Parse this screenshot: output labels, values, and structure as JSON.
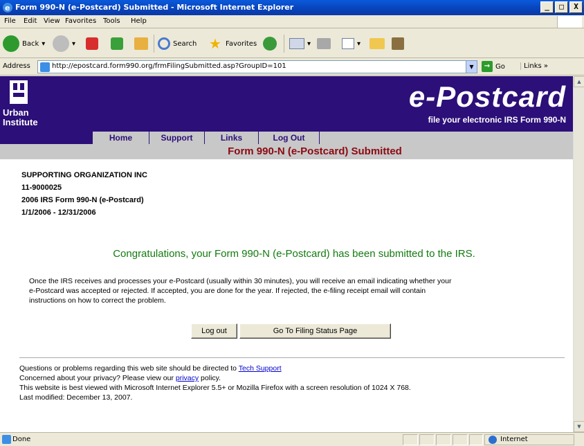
{
  "window": {
    "title": "Form 990-N (e-Postcard) Submitted - Microsoft Internet Explorer",
    "minimize": "_",
    "maximize": "□",
    "close": "X"
  },
  "menu": [
    "File",
    "Edit",
    "View",
    "Favorites",
    "Tools",
    "Help"
  ],
  "toolbar": {
    "back": "Back",
    "search": "Search",
    "favorites": "Favorites"
  },
  "address": {
    "label": "Address",
    "url": "http://epostcard.form990.org/frmFilingSubmitted.asp?GroupID=101",
    "go": "Go",
    "links": "Links"
  },
  "banner": {
    "org": "Urban Institute",
    "brand": "e-Postcard",
    "tagline": "file your electronic IRS Form 990-N"
  },
  "nav": [
    "Home",
    "Support",
    "Links",
    "Log Out"
  ],
  "page": {
    "subtitle": "Form 990-N (e-Postcard) Submitted",
    "org_name": "SUPPORTING ORGANIZATION INC",
    "ein": "11-9000025",
    "form": "2006 IRS Form 990-N (e-Postcard)",
    "period": "1/1/2006 - 12/31/2006",
    "congrats": "Congratulations, your Form 990-N (e-Postcard) has been submitted to the IRS.",
    "message_line1": "Once the IRS receives and processes your e-Postcard (usually within 30 minutes), you will receive an email indicating whether your",
    "message_line2": "e-Postcard was accepted or rejected. If accepted, you are done for the year. If rejected, the e-filing receipt email will contain",
    "message_line3": "instructions on how to correct the problem.",
    "logout_button": "Log out",
    "status_button": "Go To Filing Status Page"
  },
  "footer": {
    "line1_pre": "Questions or problems regarding this web site should be directed to ",
    "line1_link": "Tech Support",
    "line2_pre": "Concerned about your privacy? Please view our ",
    "line2_link": "privacy",
    "line2_post": " policy.",
    "line3": "This website is best viewed with Microsoft Internet Explorer 5.5+ or Mozilla Firefox with a screen resolution of 1024 X 768.",
    "line4": "Last modified: December 13, 2007."
  },
  "status": {
    "text": "Done",
    "zone": "Internet"
  },
  "colors": {
    "banner": "#2c0f78",
    "subtitle": "#8b0a12",
    "congrats": "#137a0f",
    "link": "#0000cc"
  }
}
